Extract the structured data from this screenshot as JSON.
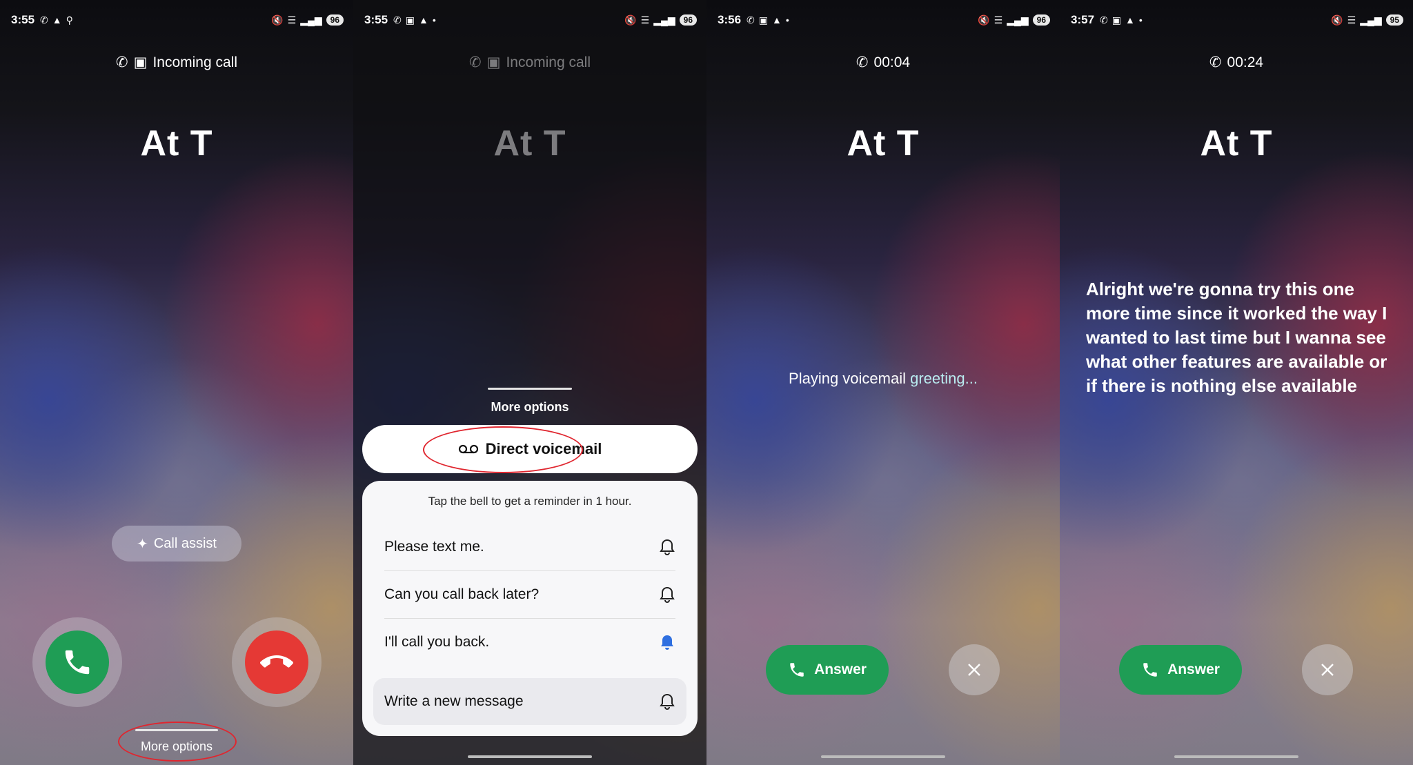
{
  "panel1": {
    "status": {
      "time": "3:55",
      "battery": "96"
    },
    "call_label": "Incoming call",
    "caller": "At T",
    "call_assist_label": "Call assist",
    "more_options_label": "More options"
  },
  "panel2": {
    "status": {
      "time": "3:55",
      "battery": "96"
    },
    "call_label": "Incoming call",
    "caller": "At T",
    "sheet_title": "More options",
    "direct_voicemail_label": "Direct voicemail",
    "reminder_hint": "Tap the bell to get a reminder in 1 hour.",
    "messages": [
      {
        "text": "Please text me.",
        "bell": "bell-outline"
      },
      {
        "text": "Can you call back later?",
        "bell": "bell-outline"
      },
      {
        "text": "I'll call you back.",
        "bell": "bell-filled"
      }
    ],
    "write_new": "Write a new message"
  },
  "panel3": {
    "status": {
      "time": "3:56",
      "battery": "96"
    },
    "timer": "00:04",
    "caller": "At T",
    "playing_a": "Playing voicemail ",
    "playing_b": "greeting...",
    "answer_label": "Answer"
  },
  "panel4": {
    "status": {
      "time": "3:57",
      "battery": "95"
    },
    "timer": "00:24",
    "caller": "At T",
    "transcript": "Alright we're gonna try this one more time since it worked the way I wanted to last time but I wanna see what other features are available or if there is nothing else available",
    "answer_label": "Answer"
  },
  "colors": {
    "accept": "#1f9d55",
    "decline": "#e53935",
    "annotation": "#e0262f",
    "bell_active": "#2f6fe0"
  }
}
